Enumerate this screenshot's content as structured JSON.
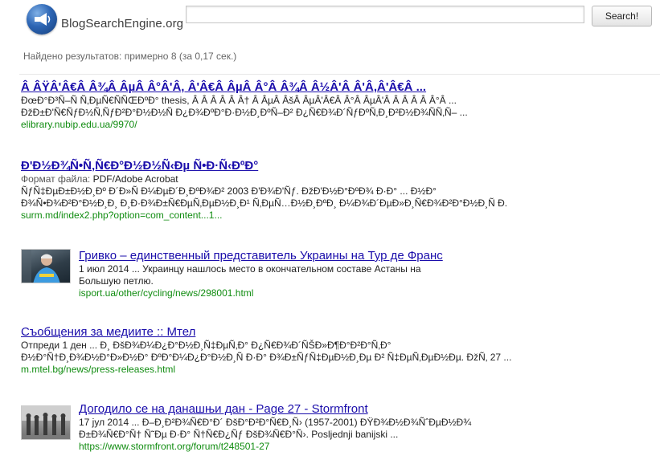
{
  "logo": {
    "text": "BlogSearchEngine.org",
    "icon": "megaphone-icon"
  },
  "search": {
    "value": "",
    "placeholder": "",
    "button_label": "Search!"
  },
  "stats": "Найдено результатов: примерно 8 (за 0,17 сек.)",
  "colors": {
    "link": "#1a0dab",
    "url": "#108c10",
    "meta": "#555555"
  },
  "results": [
    {
      "title": "Â ÂŸÂ'Â€Â Â¾Â ÂµÂ Â°Â'Â, Â'Â€Â ÂµÂ Â°Â Â¾Â Â½Â'Â Â'Â,Â'Â€Â ...",
      "snippet": [
        "ÐœÐ°Ð³Ñ–Ñ Ñ‚ÐµÑ€ÑÑŒÐºÐ° thesis, Â Â Â Â Â Â† Â ÂµÂ ÂšÂ ÂµÂ'Â€Â Â°Â ÂµÂ'Â Â Â Â Â Â°Â ...",
        "ÐžÐ±Ð'Ñ€ÑƒÐ½Ñ‚ÑƒÐ²Ð°Ð½Ð½Ñ Ð¿Ð¾ÐºÐ°Ð·Ð½Ð¸ÐºÑ–Ð² Ð¿Ñ€Ð¾Ð´ÑƒÐºÑ‚Ð¸Ð²Ð½Ð¾ÑÑ‚Ñ– ..."
      ],
      "url": "elibrary.nubip.edu.ua/9970/"
    },
    {
      "title": "Ð'Ð½Ð¾Ñ•Ñ‚Ñ€Ð°Ð½Ð½Ñ‹Ðµ Ñ•Ð·Ñ‹ÐºÐ°",
      "meta_label": "Формат файла:",
      "meta_value": "PDF/Adobe Acrobat",
      "snippet": [
        "ÑƒÑ‡ÐµÐ±Ð½Ð¸Ðº Ð´Ð»Ñ Ð¼ÐµÐ´Ð¸ÐºÐ¾Ð² 2003 Ð'Ð¾Ð'Ñƒ. ÐžÐ'Ð½Ð°ÐºÐ¾ Ð·Ð° ... Ð½Ð°",
        "Ð¾Ñ•Ð¾Ð²Ð°Ð½Ð¸Ð¸ Ð¸Ð·Ð¾Ð±Ñ€ÐµÑ‚ÐµÐ½Ð¸Ð¹ Ñ‚ÐµÑ…Ð½Ð¸ÐºÐ¸ Ð¼Ð¾Ð´ÐµÐ»Ð¸Ñ€Ð¾Ð²Ð°Ð½Ð¸Ñ Ð."
      ],
      "url": "surm.md/index2.php?option=com_content...1..."
    },
    {
      "title": "Гривко – единственный представитель Украины на Тур де Франс",
      "snippet": [
        "1 июл 2014 ... Украинцу нашлось место в окончательном составе Астаны на",
        "Большую петлю."
      ],
      "url": "isport.ua/other/cycling/news/298001.html",
      "thumb": "cyclist-photo"
    },
    {
      "title": "Съобщения за медиите :: Мтел",
      "snippet": [
        "Отпреди 1 ден ... Ð¸ ÐšÐ¾Ð¼Ð¿Ð°Ð½Ð¸Ñ‡ÐµÑ‚Ð° Ð¿Ñ€Ð¾Ð´ÑŠÐ»Ð¶Ð°Ð²Ð°Ñ‚Ð°",
        "Ð½Ð°Ñ†Ð¸Ð¾Ð½Ð°Ð»Ð½Ð° ÐºÐ°Ð¼Ð¿Ð°Ð½Ð¸Ñ Ð·Ð° Ð¾Ð±ÑƒÑ‡ÐµÐ½Ð¸Ðµ Ð² Ñ‡ÐµÑ‚ÐµÐ½Ðµ. ÐžÑ‚ 27 ..."
      ],
      "url": "m.mtel.bg/news/press-releases.html"
    },
    {
      "title": "Догодило се на данашњи дан - Page 27 - Stormfront",
      "snippet": [
        "17 јул 2014 ... Ð–Ð¸Ð²Ð¾Ñ€Ð°Ð´ ÐšÐ°Ð²Ð°Ñ€Ð¸Ñ› (1957-2001) ÐŸÐ¾Ð½Ð¾ÑˆÐµÐ½Ð¾",
        "Ð±Ð¾Ñ€Ð°Ñ† Ñ˜Ðµ Ð·Ð° Ñ†Ñ€Ð¿Ñƒ ÐšÐ¾Ñ€Ð°Ñ›. Posljednji banijski ..."
      ],
      "url": "https://www.stormfront.org/forum/t248501-27",
      "thumb": "soldiers-photo"
    }
  ]
}
